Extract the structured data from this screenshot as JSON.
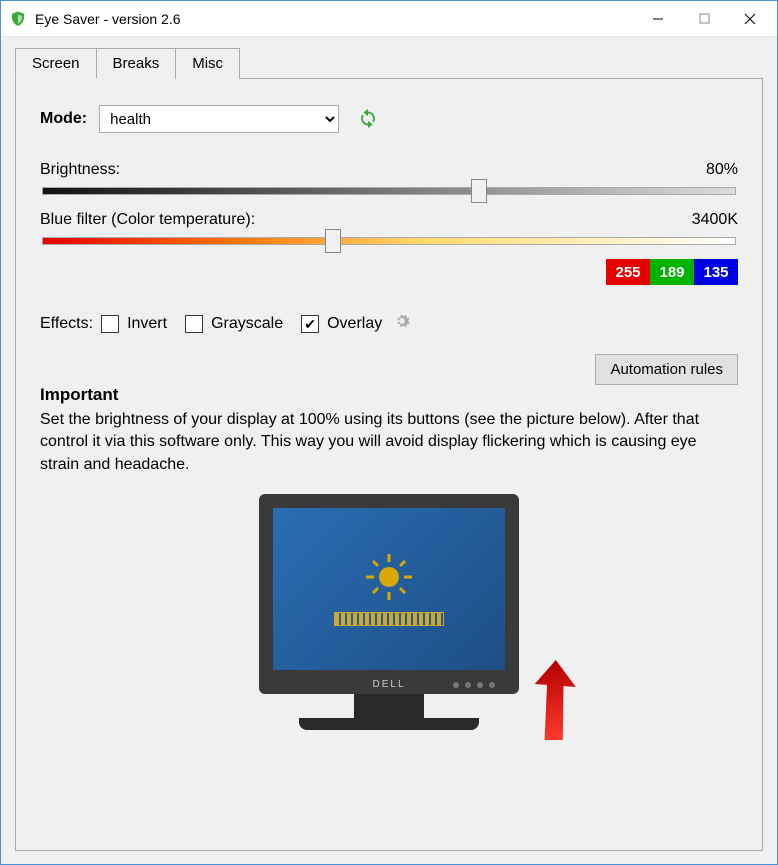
{
  "window": {
    "title": "Eye Saver - version 2.6"
  },
  "tabs": [
    {
      "label": "Screen",
      "active": true
    },
    {
      "label": "Breaks",
      "active": false
    },
    {
      "label": "Misc",
      "active": false
    }
  ],
  "mode": {
    "label": "Mode:",
    "value": "health"
  },
  "brightness": {
    "label": "Brightness:",
    "value_text": "80%",
    "percent": 63
  },
  "bluefilter": {
    "label": "Blue filter (Color temperature):",
    "value_text": "3400K",
    "percent": 42
  },
  "rgb": {
    "r": "255",
    "g": "189",
    "b": "135"
  },
  "effects": {
    "label": "Effects:",
    "invert": {
      "label": "Invert",
      "checked": false
    },
    "grayscale": {
      "label": "Grayscale",
      "checked": false
    },
    "overlay": {
      "label": "Overlay",
      "checked": true
    }
  },
  "automation_button": "Automation rules",
  "important": {
    "heading": "Important",
    "body": "Set the brightness of your display at 100% using its buttons (see the picture below). After that control it via this software only. This way you will avoid display flickering which is causing eye strain and headache."
  },
  "monitor_logo": "DELL"
}
